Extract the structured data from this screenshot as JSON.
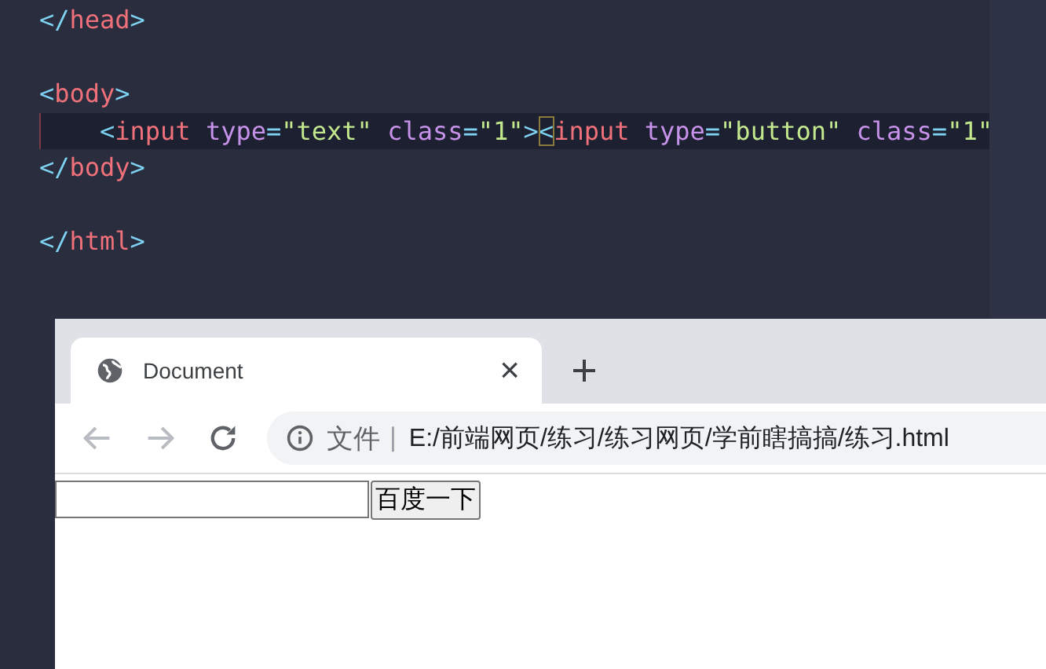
{
  "editor": {
    "lines": [
      {
        "current": false,
        "indented": false,
        "tokens": [
          {
            "kind": "punct",
            "text": "</"
          },
          {
            "kind": "tag",
            "text": "head"
          },
          {
            "kind": "punct",
            "text": ">"
          }
        ]
      },
      {
        "current": false
      },
      {
        "current": false,
        "indented": false,
        "tokens": [
          {
            "kind": "punct",
            "text": "<"
          },
          {
            "kind": "tag",
            "text": "body"
          },
          {
            "kind": "punct",
            "text": ">"
          }
        ]
      },
      {
        "current": true,
        "indented": true,
        "tokens": [
          {
            "kind": "punct",
            "text": "<"
          },
          {
            "kind": "tag",
            "text": "input"
          },
          {
            "kind": "attr",
            "text": "type"
          },
          {
            "kind": "punct",
            "text": "="
          },
          {
            "kind": "string",
            "text": "\"text\""
          },
          {
            "kind": "attr",
            "text": "class"
          },
          {
            "kind": "punct",
            "text": "="
          },
          {
            "kind": "string",
            "text": "\"1\""
          },
          {
            "kind": "punct",
            "text": ">"
          },
          {
            "kind": "punct",
            "text": "<",
            "bracket_match": true
          },
          {
            "kind": "tag",
            "text": "input"
          },
          {
            "kind": "attr",
            "text": "type"
          },
          {
            "kind": "punct",
            "text": "="
          },
          {
            "kind": "string",
            "text": "\"button\""
          },
          {
            "kind": "attr",
            "text": "class"
          },
          {
            "kind": "punct",
            "text": "="
          },
          {
            "kind": "string",
            "text": "\"1\""
          }
        ]
      },
      {
        "current": false,
        "indented": false,
        "tokens": [
          {
            "kind": "punct",
            "text": "</"
          },
          {
            "kind": "tag",
            "text": "body"
          },
          {
            "kind": "punct",
            "text": ">"
          }
        ]
      },
      {
        "current": false
      },
      {
        "current": false,
        "indented": false,
        "tokens": [
          {
            "kind": "punct",
            "text": "</"
          },
          {
            "kind": "tag",
            "text": "html"
          },
          {
            "kind": "punct",
            "text": ">"
          }
        ]
      }
    ]
  },
  "browser": {
    "tabs": [
      {
        "title": "Document",
        "selected": true,
        "close": "×"
      }
    ],
    "address": {
      "label": "文件",
      "separator": "|",
      "url": "E:/前端网页/练习/练习网页/学前瞎搞搞/练习.html"
    },
    "page": {
      "button": "百度一下"
    }
  }
}
